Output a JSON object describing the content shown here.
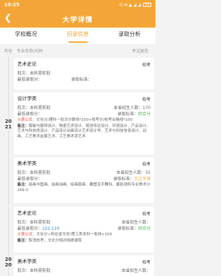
{
  "status_bar": {
    "time": "19:25",
    "icons": "G ✉ ▲ ◢ ◢",
    "battery": "31"
  },
  "header": {
    "title": "大学详情"
  },
  "tabs": [
    {
      "label": "学校概况"
    },
    {
      "label": "招录信息"
    },
    {
      "label": "录取分析"
    }
  ],
  "columns": {
    "year": "年份",
    "major": "专业名称/代码",
    "type": "考试类型"
  },
  "labels": {
    "batch": "批次：",
    "min_score": "最低录取分：",
    "plan": "本省招生人数：",
    "standard": "录取标准：",
    "calc": "计算公式：",
    "remark": "备注："
  },
  "groups": [
    {
      "year": "2021",
      "cards": [
        {
          "name": "艺术史论",
          "type": "校考",
          "batch": "本科提前批",
          "min_score": "",
          "plan": "",
          "standard": "",
          "calc": "",
          "remark": ""
        },
        {
          "name": "设计学类",
          "type": "校考",
          "batch": "本科提前批",
          "min_score": "",
          "plan": "170",
          "standard": "综合分",
          "calc": "文化分/理科一批次分数线*100+校考分/校考合格线*100",
          "remark": "服装与服饰设计、陶瓷艺术设计、视觉传达设计、环境设计、产品设计、艺术与科技类设计、产品设计动画设计艺术设计学、艺术与科技信息设计、动画、工艺美术金属艺术、工艺美术漆艺术"
        },
        {
          "name": "美术学类",
          "type": "校考",
          "batch": "本科提前批",
          "min_score": "",
          "plan": "55",
          "standard": "文过专排",
          "calc": "",
          "remark": "绘画中国画、绘画油画、绘画版画、雕塑及手舞科、摄影测科专业美术分269.0"
        }
      ]
    },
    {
      "year": "2020",
      "cards": [
        {
          "name": "艺术史论",
          "type": "校考",
          "batch": "本科提前批",
          "min_score": "122.119",
          "plan": "",
          "standard": "综合分",
          "calc": "文化分÷所在省文史/理工类本科一批线×100",
          "remark": "取消校考，文化分相对成绩录取"
        },
        {
          "name": "美术学类",
          "type": "校考",
          "batch": "本科提前批",
          "min_score": "",
          "plan": "",
          "standard": "",
          "calc": "",
          "remark": ""
        }
      ]
    }
  ]
}
